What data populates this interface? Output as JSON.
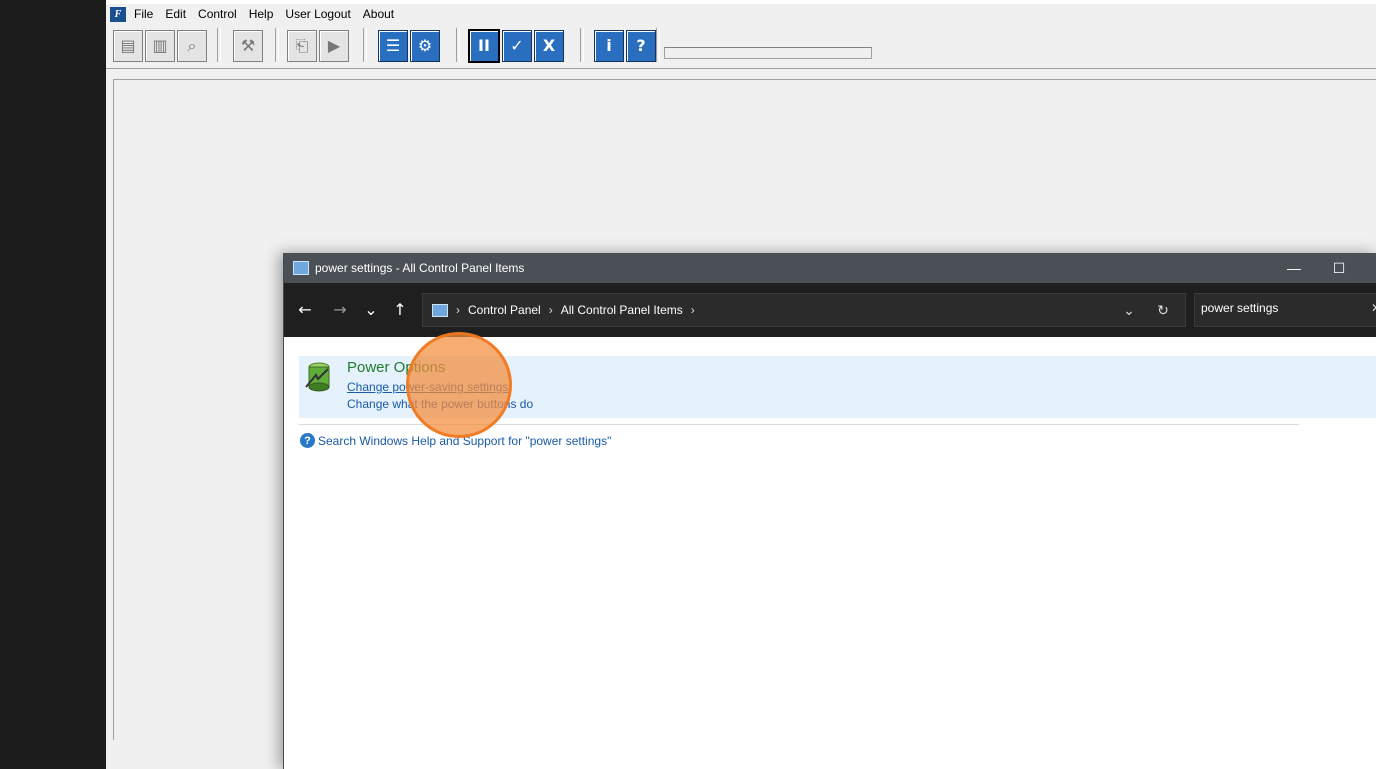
{
  "app": {
    "menu": [
      "File",
      "Edit",
      "Control",
      "Help",
      "User Logout",
      "About"
    ],
    "toolbar_glyphs": {
      "report": "▤",
      "document": "▥",
      "search": "⌕",
      "tools": "⚒",
      "doc_import": "⎗",
      "doc_play": "▶",
      "list": "☰",
      "doc_settings": "⚙",
      "pause": "II",
      "doc_check": "✓",
      "close": "X",
      "info": "i",
      "help": "?"
    }
  },
  "control_panel": {
    "title": "power settings - All Control Panel Items",
    "window_controls": {
      "minimize": "—",
      "maximize": "☐"
    },
    "nav": {
      "back": "←",
      "forward": "→",
      "recent": "⌄",
      "up": "↑"
    },
    "breadcrumb": [
      "Control Panel",
      "All Control Panel Items"
    ],
    "breadcrumb_sep": "›",
    "address_dropdown": "⌄",
    "refresh": "↻",
    "search": {
      "value": "power settings",
      "clear": "✕"
    },
    "result": {
      "title": "Power Options",
      "links": [
        "Change power-saving settings",
        "Change what the power buttons do"
      ]
    },
    "help": {
      "icon": "?",
      "text": "Search Windows Help and Support for \"power settings\""
    }
  }
}
